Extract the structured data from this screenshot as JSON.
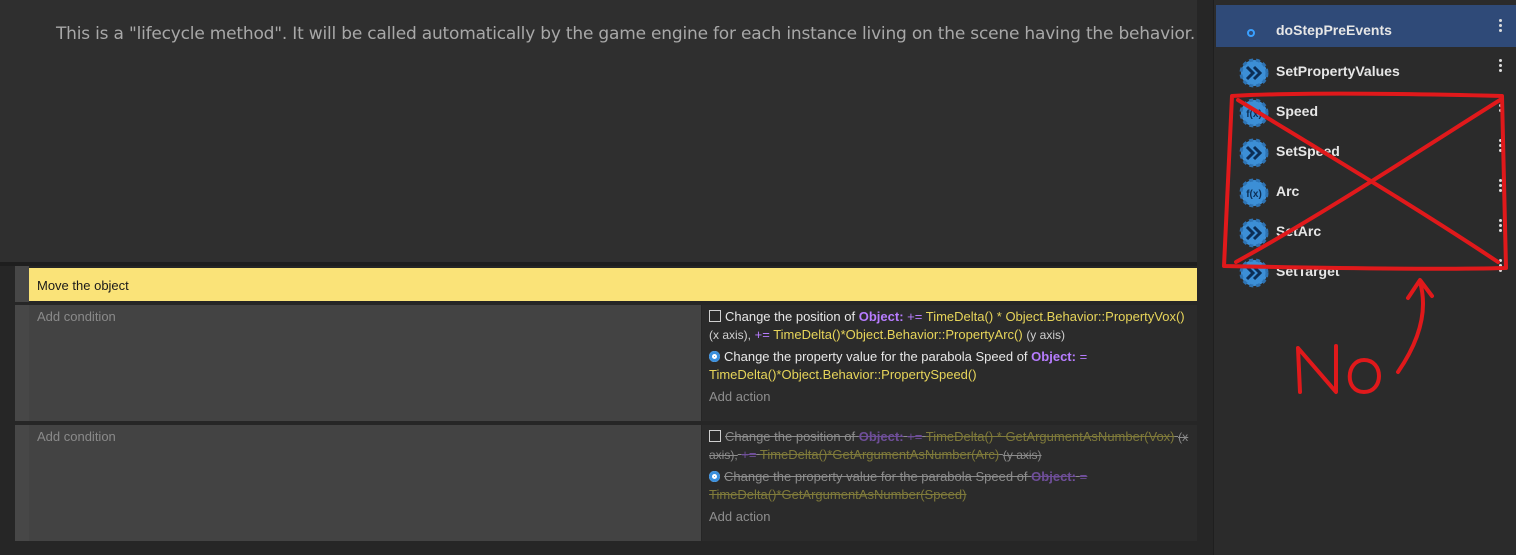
{
  "description": "This is a \"lifecycle method\". It will be called automatically by the game engine for each instance living on the scene having the behavior.",
  "event_comment": "Move the object",
  "events": [
    {
      "condition_placeholder": "Add condition",
      "add_action": "Add action",
      "actions": [
        {
          "icon": "position-icon",
          "intro": "Change the position of",
          "object": "Object",
          "colon": ":",
          "op1": "+=",
          "expr1": "TimeDelta() * Object.Behavior::PropertyVox()",
          "note1": "(x axis),",
          "op2": "+=",
          "expr2": "TimeDelta()*Object.Behavior::PropertyArc()",
          "note2": "(y axis)"
        },
        {
          "icon": "behavior-gear-icon",
          "intro": "Change the property value for the parabola Speed of",
          "object": "Object",
          "colon": ":",
          "op": "=",
          "expr": "TimeDelta()*Object.Behavior::PropertySpeed()"
        }
      ]
    },
    {
      "condition_placeholder": "Add condition",
      "add_action": "Add action",
      "disabled": true,
      "actions": [
        {
          "icon": "position-icon",
          "intro": "Change the position of",
          "object": "Object",
          "colon": ":",
          "op1": "+=",
          "expr1": "TimeDelta() * GetArgumentAsNumber(Vox)",
          "note1": "(x axis),",
          "op2": "+=",
          "expr2": "TimeDelta()*GetArgumentAsNumber(Arc)",
          "note2": "(y axis)"
        },
        {
          "icon": "behavior-gear-icon",
          "intro": "Change the property value for the parabola Speed of",
          "object": "Object",
          "colon": ":",
          "op": "=",
          "expr": "TimeDelta()*GetArgumentAsNumber(Speed)"
        }
      ]
    }
  ],
  "sidebar": {
    "items": [
      {
        "label": "doStepPreEvents",
        "icon": "lifecycle-icon",
        "selected": true
      },
      {
        "label": "SetPropertyValues",
        "icon": "action-icon"
      },
      {
        "label": "Speed",
        "icon": "expression-icon"
      },
      {
        "label": "SetSpeed",
        "icon": "action-icon"
      },
      {
        "label": "Arc",
        "icon": "expression-icon"
      },
      {
        "label": "SetArc",
        "icon": "action-icon"
      },
      {
        "label": "SetTarget",
        "icon": "action-icon"
      }
    ]
  },
  "annotation": {
    "text": "No",
    "color": "#e0191b"
  }
}
